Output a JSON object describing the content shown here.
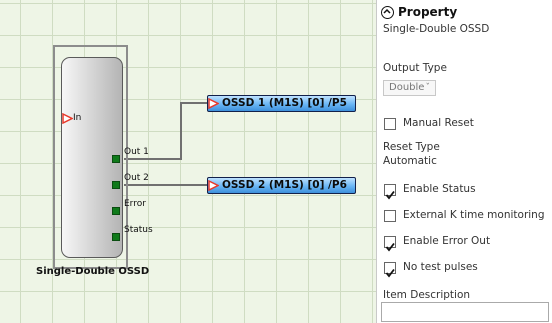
{
  "block": {
    "title": "Single-Double OSSD",
    "input_label": "In",
    "outputs": [
      "Out 1",
      "Out 2",
      "Error",
      "Status"
    ]
  },
  "output_nodes": [
    {
      "label": "OSSD 1 (M1S) [0] /P5"
    },
    {
      "label": "OSSD 2 (M1S) [0] /P6"
    }
  ],
  "panel": {
    "header": "Property",
    "subtitle": "Single-Double OSSD",
    "output_type_label": "Output Type",
    "output_type_value": "Double",
    "manual_reset_label": "Manual Reset",
    "manual_reset_checked": false,
    "reset_type_label": "Reset Type",
    "reset_type_value": "Automatic",
    "checkboxes": [
      {
        "label": "Enable Status",
        "checked": true
      },
      {
        "label": "External K time monitoring",
        "checked": false
      },
      {
        "label": "Enable Error Out",
        "checked": true
      },
      {
        "label": "No test pulses",
        "checked": true
      }
    ],
    "item_description_label": "Item Description"
  },
  "colors": {
    "canvas_bg": "#eef5e6",
    "port_green": "#0f7a1a",
    "node_blue": "#69b6f5",
    "input_triangle": "#e8392b"
  }
}
